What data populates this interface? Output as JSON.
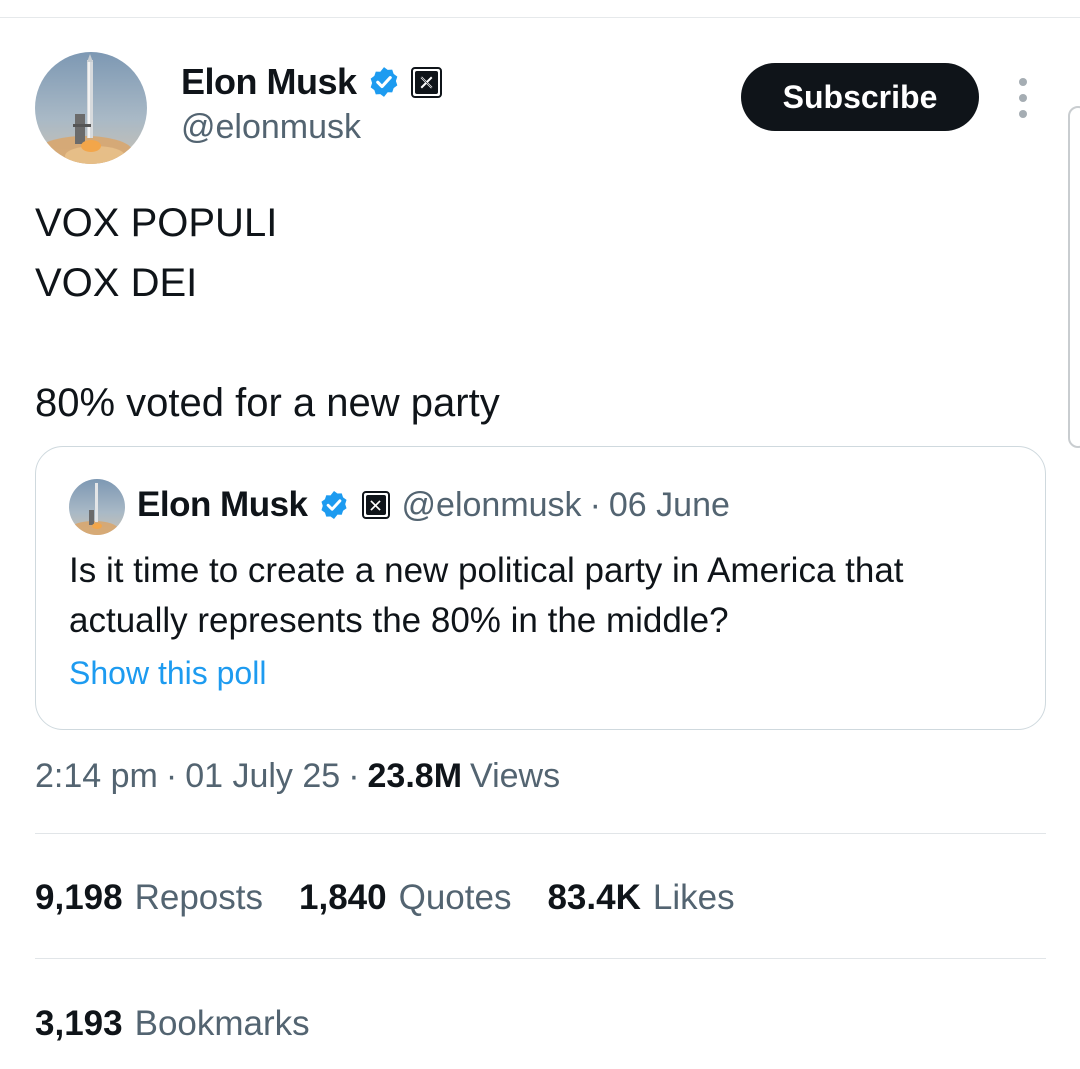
{
  "author": {
    "name": "Elon Musk",
    "handle": "@elonmusk",
    "verified": true,
    "affiliate_badge": "x-logo-icon"
  },
  "actions": {
    "subscribe_label": "Subscribe",
    "more_icon": "more-vertical-icon"
  },
  "tweet": {
    "lines": [
      "VOX POPULI",
      "VOX DEI",
      "80% voted for a new party"
    ]
  },
  "quote": {
    "name": "Elon Musk",
    "handle": "@elonmusk",
    "separator": "·",
    "date": "06 June",
    "text": "Is it time to create a new political party in America that actually represents the 80% in the middle?",
    "link_label": "Show this poll"
  },
  "meta": {
    "time": "2:14 pm",
    "date": "01 July 25",
    "separator": "·",
    "views_count": "23.8M",
    "views_label": "Views"
  },
  "stats": {
    "reposts_count": "9,198",
    "reposts_label": "Reposts",
    "quotes_count": "1,840",
    "quotes_label": "Quotes",
    "likes_count": "83.4K",
    "likes_label": "Likes",
    "bookmarks_count": "3,193",
    "bookmarks_label": "Bookmarks"
  },
  "colors": {
    "text": "#0f1419",
    "secondary": "#536471",
    "link": "#1d9bf0",
    "verified": "#1d9bf0",
    "border": "#cfd9de"
  }
}
